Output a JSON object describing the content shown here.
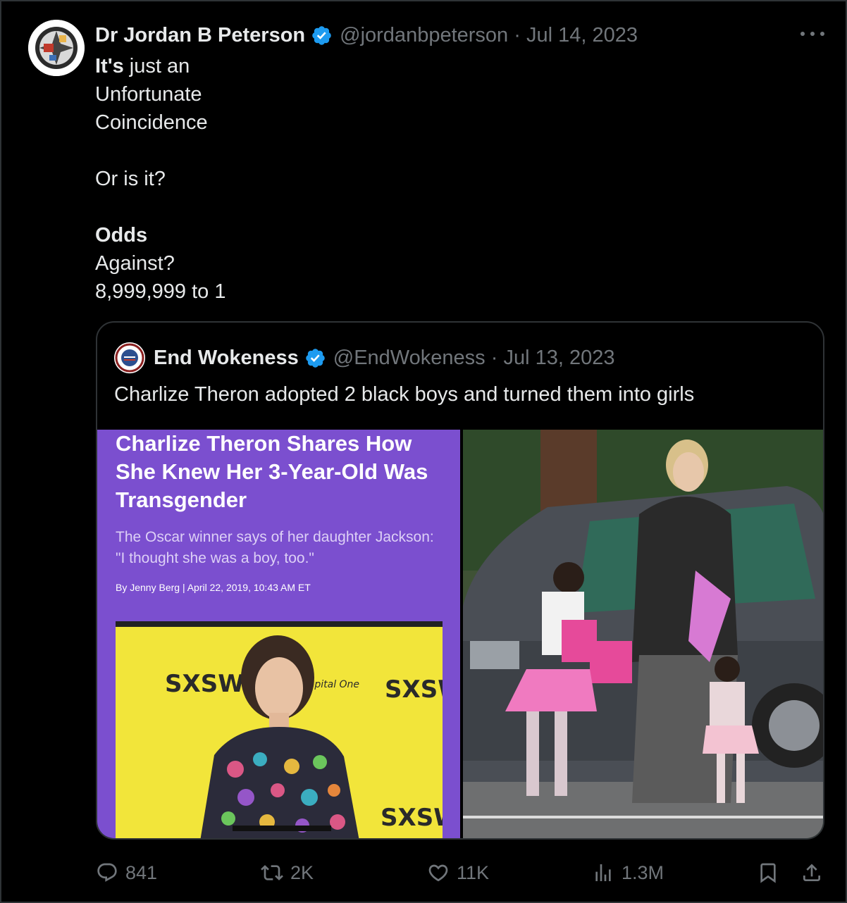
{
  "tweet": {
    "author_name": "Dr Jordan B Peterson",
    "handle": "@jordanbpeterson",
    "separator": "·",
    "date": "Jul 14, 2023",
    "lines": [
      {
        "bold": "It's",
        "rest": " just an"
      },
      {
        "bold": "",
        "rest": "Unfortunate"
      },
      {
        "bold": "",
        "rest": "Coincidence"
      },
      {
        "bold": "",
        "rest": ""
      },
      {
        "bold": "",
        "rest": "Or is it?"
      },
      {
        "bold": "",
        "rest": ""
      },
      {
        "bold": "Odds",
        "rest": ""
      },
      {
        "bold": "",
        "rest": "Against?"
      },
      {
        "bold": "",
        "rest": "8,999,999 to 1"
      }
    ]
  },
  "quoted": {
    "author_name": "End Wokeness",
    "handle": "@EndWokeness",
    "separator": "·",
    "date": "Jul 13, 2023",
    "text": "Charlize Theron adopted 2 black boys and turned them into girls",
    "article": {
      "headline": "Charlize Theron Shares How She Knew Her 3-Year-Old Was Transgender",
      "dek": "The Oscar winner says of her daughter Jackson: \"I thought she was a boy, too.\"",
      "byline": "By Jenny Berg | April 22, 2019, 10:43 AM ET",
      "backdrop_text": [
        "SXSW",
        "SXSW",
        "Capital One",
        "SXSW"
      ]
    }
  },
  "actions": {
    "replies": "841",
    "reposts": "2K",
    "likes": "11K",
    "views": "1.3M"
  },
  "colors": {
    "background": "#000000",
    "text": "#e7e9ea",
    "muted": "#71767b",
    "verified": "#1d9bf0",
    "border": "#2f3336",
    "article_purple": "#7b4fcf",
    "backdrop_yellow": "#f2e53a"
  },
  "icons": [
    "verified-badge-icon",
    "more-options-icon",
    "reply-icon",
    "repost-icon",
    "like-icon",
    "views-icon",
    "bookmark-icon",
    "share-icon"
  ]
}
